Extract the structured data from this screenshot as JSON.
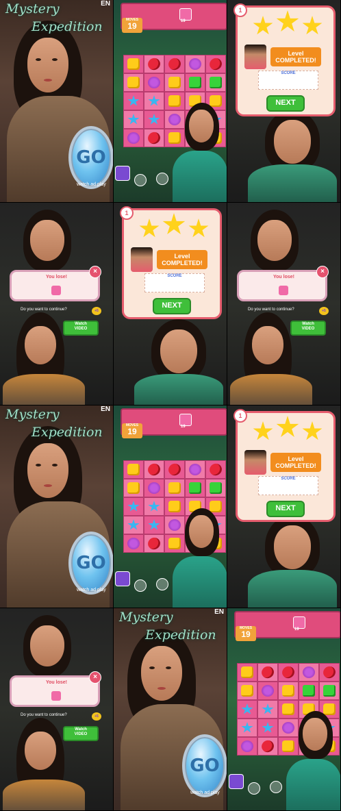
{
  "title_screen": {
    "title_line1": "Mystery",
    "title_line2": "Expedition",
    "lang_tag": "EN",
    "go_label": "GO",
    "ad_label": "watch ad play"
  },
  "game_screen": {
    "moves_label": "MOVES",
    "moves_value": "19",
    "target_count": "19"
  },
  "level_complete": {
    "number": "1",
    "badge_line1": "Level",
    "badge_line2": "COMPLETED!",
    "score_label": "SCORE",
    "next_label": "NEXT"
  },
  "you_lose": {
    "title": "You lose!",
    "question": "Do you want to continue?",
    "watch_line1": "Watch",
    "watch_line2": "VIDEO",
    "bonus": "+5",
    "close_icon": "close-icon"
  },
  "colors": {
    "accent_pink": "#e04c7c",
    "go_blue": "#6fc3ef",
    "next_green": "#3fbf3a",
    "badge_orange": "#f28d1e"
  }
}
